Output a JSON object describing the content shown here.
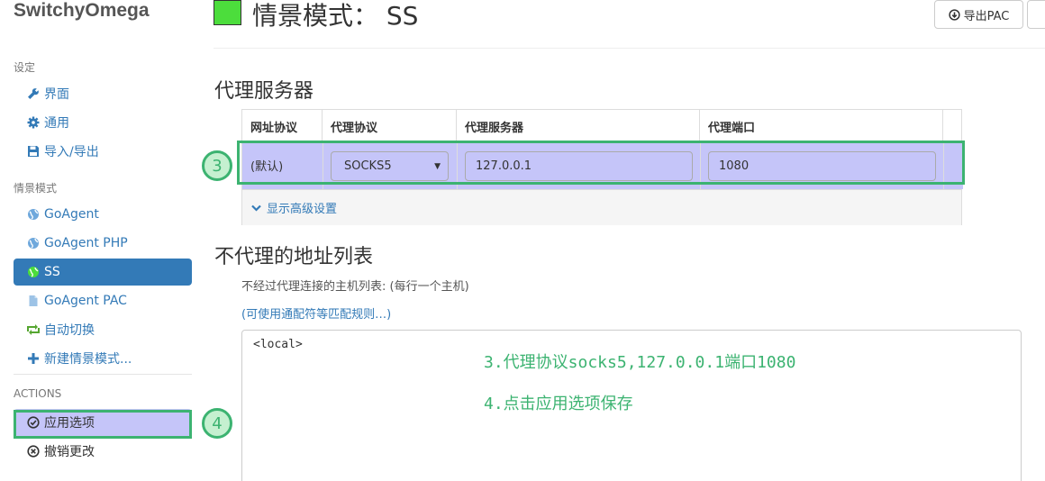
{
  "app": {
    "brand": "SwitchyOmega"
  },
  "sidebar": {
    "settings_header": "设定",
    "settings": [
      {
        "label": "界面",
        "icon": "wrench-icon"
      },
      {
        "label": "通用",
        "icon": "gear-icon"
      },
      {
        "label": "导入/导出",
        "icon": "floppy-icon"
      }
    ],
    "profiles_header": "情景模式",
    "profiles": [
      {
        "label": "GoAgent",
        "icon": "globe-icon"
      },
      {
        "label": "GoAgent PHP",
        "icon": "globe-icon"
      },
      {
        "label": "SS",
        "icon": "globe-icon",
        "active": true
      },
      {
        "label": "GoAgent PAC",
        "icon": "file-icon"
      },
      {
        "label": "自动切换",
        "icon": "switch-icon"
      },
      {
        "label": "新建情景模式...",
        "icon": "plus-icon"
      }
    ],
    "actions_header": "ACTIONS",
    "actions": [
      {
        "label": "应用选项",
        "icon": "check-circle-icon"
      },
      {
        "label": "撤销更改",
        "icon": "x-circle-icon"
      }
    ]
  },
  "header": {
    "title": "情景模式： SS",
    "color": "#4cdd3c",
    "export_label": "导出PAC"
  },
  "proxy": {
    "heading": "代理服务器",
    "columns": [
      "网址协议",
      "代理协议",
      "代理服务器",
      "代理端口"
    ],
    "row": {
      "scheme": "(默认)",
      "protocol": "SOCKS5",
      "server": "127.0.0.1",
      "port": "1080"
    },
    "advanced_label": "显示高级设置"
  },
  "bypass": {
    "heading": "不代理的地址列表",
    "help": "不经过代理连接的主机列表: (每行一个主机)",
    "link": "(可使用通配符等匹配规则…)",
    "text": "<local>"
  },
  "annotations": {
    "marker_3": "3",
    "marker_4": "4",
    "note_1": "3.代理协议socks5,127.0.0.1端口1080",
    "note_2": "4.点击应用选项保存",
    "color": "#3cb371"
  }
}
